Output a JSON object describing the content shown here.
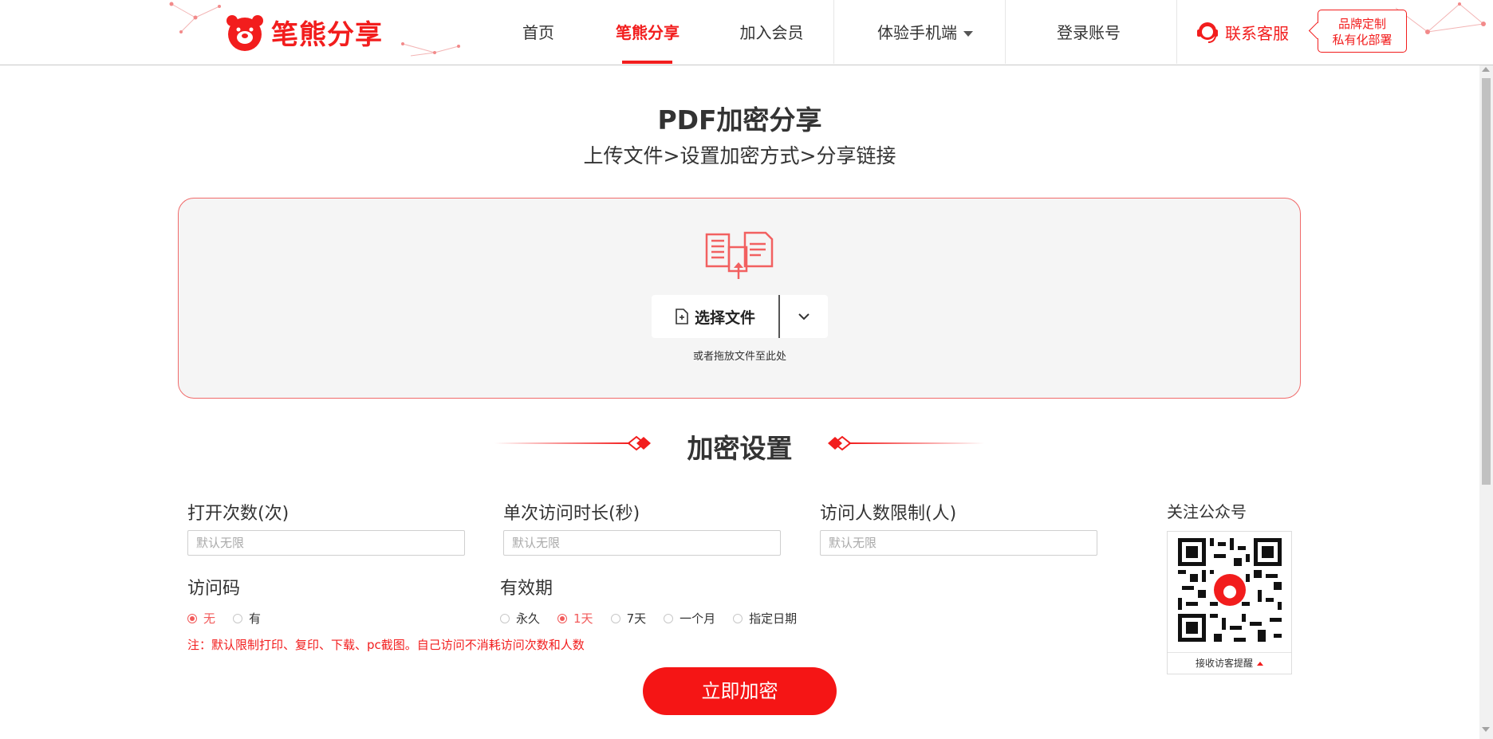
{
  "header": {
    "logo_text": "笔熊分享",
    "nav": [
      {
        "label": "首页"
      },
      {
        "label": "笔熊分享"
      },
      {
        "label": "加入会员"
      },
      {
        "label": "体验手机端"
      },
      {
        "label": "登录账号"
      }
    ],
    "contact_label": "联系客服",
    "brand_line1": "品牌定制",
    "brand_line2": "私有化部署",
    "accent_color": "#f21d1d"
  },
  "main": {
    "title": "PDF加密分享",
    "steps": "上传文件>设置加密方式>分享链接",
    "choose_file_label": "选择文件",
    "drop_hint": "或者拖放文件至此处",
    "section_title": "加密设置",
    "fields": {
      "open_count_label": "打开次数(次)",
      "open_count_placeholder": "默认无限",
      "duration_label": "单次访问时长(秒)",
      "duration_placeholder": "默认无限",
      "visitor_limit_label": "访问人数限制(人)",
      "visitor_limit_placeholder": "默认无限"
    },
    "access_code": {
      "label": "访问码",
      "options": [
        "无",
        "有"
      ],
      "selected": "无"
    },
    "validity": {
      "label": "有效期",
      "options": [
        "永久",
        "1天",
        "7天",
        "一个月",
        "指定日期"
      ],
      "selected": "1天"
    },
    "note": "注：默认限制打印、复印、下载、pc截图。自己访问不消耗访问次数和人数",
    "submit_label": "立即加密"
  },
  "sidebar": {
    "follow_label": "关注公众号",
    "qr_footer": "接收访客提醒"
  }
}
